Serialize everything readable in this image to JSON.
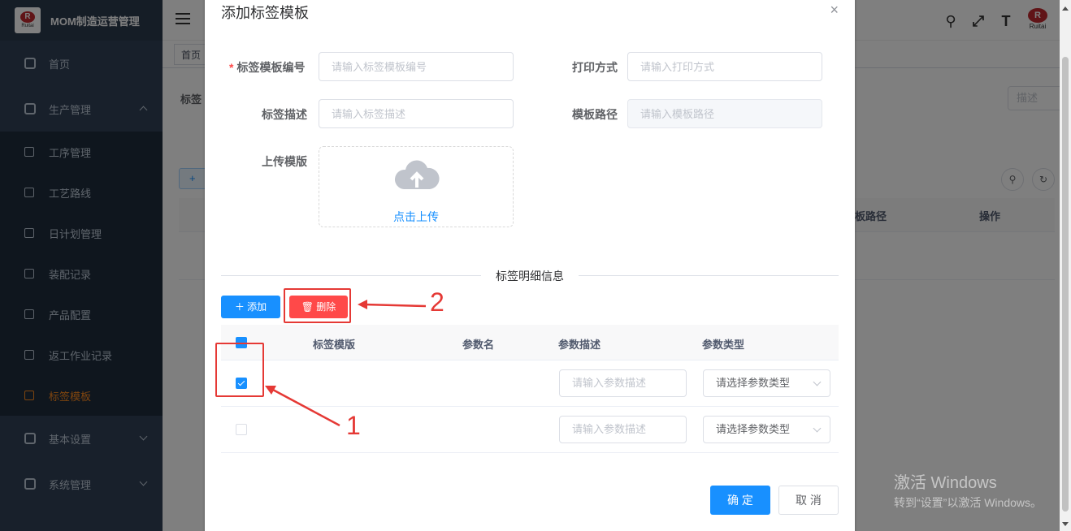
{
  "app": {
    "title": "MOM制造运营管理",
    "logo_text": "Ruitai",
    "logo_glyph": "R"
  },
  "sidebar": {
    "items": [
      {
        "label": "首页",
        "icon": "dashboard-icon"
      },
      {
        "label": "生产管理",
        "icon": "production-icon",
        "expanded": true
      },
      {
        "label": "基本设置",
        "icon": "settings-sliders-icon"
      },
      {
        "label": "系统管理",
        "icon": "gear-icon"
      }
    ],
    "production_children": [
      {
        "label": "工序管理"
      },
      {
        "label": "工艺路线"
      },
      {
        "label": "日计划管理"
      },
      {
        "label": "装配记录"
      },
      {
        "label": "产品配置"
      },
      {
        "label": "返工作业记录"
      },
      {
        "label": "标签模板",
        "active": true
      }
    ]
  },
  "navbar": {
    "tag_home": "首页",
    "nav_icons": [
      "search-icon",
      "fullscreen-icon",
      "font-size-icon"
    ]
  },
  "underlay": {
    "label": "标签",
    "search_placeholder": "描述",
    "add_label": "+",
    "col_template_path": "板路径",
    "col_actions": "操作"
  },
  "dialog": {
    "title": "添加标签模板",
    "close": "×",
    "fields": {
      "code_label": "标签模板编号",
      "code_placeholder": "请输入标签模板编号",
      "print_label": "打印方式",
      "print_placeholder": "请输入打印方式",
      "desc_label": "标签描述",
      "desc_placeholder": "请输入标签描述",
      "path_label": "模板路径",
      "path_placeholder": "请输入模板路径",
      "upload_label": "上传模版",
      "upload_text": "点击上传"
    },
    "divider": "标签明细信息",
    "add_button": "添加",
    "delete_button": "删除",
    "table": {
      "headers": [
        "标签模版",
        "参数名",
        "参数描述",
        "参数类型"
      ],
      "rows": [
        {
          "checked": true,
          "desc_placeholder": "请输入参数描述",
          "type_placeholder": "请选择参数类型"
        },
        {
          "checked": false,
          "desc_placeholder": "请输入参数描述",
          "type_placeholder": "请选择参数类型"
        }
      ]
    },
    "confirm": "确 定",
    "cancel": "取 消"
  },
  "annotations": {
    "label_1": "1",
    "label_2": "2"
  },
  "watermark": {
    "line1": "激活 Windows",
    "line2": "转到“设置”以激活 Windows。"
  },
  "colors": {
    "primary": "#1890ff",
    "danger": "#ff4949",
    "sidebar_bg": "#304156",
    "active_menu": "#ff8a1f",
    "annotation": "#e53935"
  }
}
